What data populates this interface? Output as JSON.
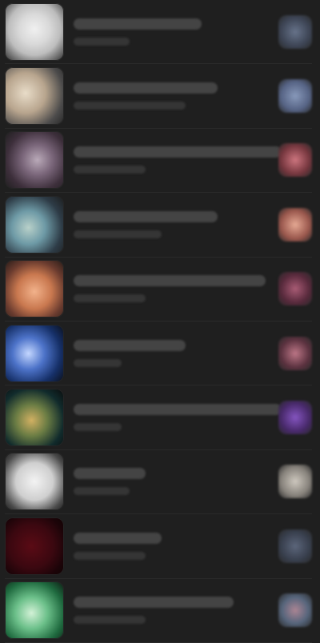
{
  "list": {
    "items": [
      {
        "thumb_name": "app-thumbnail-1",
        "right_icon_name": "app-badge-icon-1"
      },
      {
        "thumb_name": "app-thumbnail-2",
        "right_icon_name": "app-badge-icon-2"
      },
      {
        "thumb_name": "app-thumbnail-3",
        "right_icon_name": "app-badge-icon-3"
      },
      {
        "thumb_name": "app-thumbnail-4",
        "right_icon_name": "app-badge-icon-4"
      },
      {
        "thumb_name": "app-thumbnail-5",
        "right_icon_name": "app-badge-icon-5"
      },
      {
        "thumb_name": "app-thumbnail-6",
        "right_icon_name": "app-badge-icon-6"
      },
      {
        "thumb_name": "app-thumbnail-7",
        "right_icon_name": "app-badge-icon-7"
      },
      {
        "thumb_name": "app-thumbnail-8",
        "right_icon_name": "app-badge-icon-8"
      },
      {
        "thumb_name": "app-thumbnail-9",
        "right_icon_name": "app-badge-icon-9"
      },
      {
        "thumb_name": "app-thumbnail-10",
        "right_icon_name": "app-badge-icon-10"
      }
    ]
  },
  "colors": {
    "background": "#1f1f1f",
    "divider": "#2a2a2a"
  }
}
